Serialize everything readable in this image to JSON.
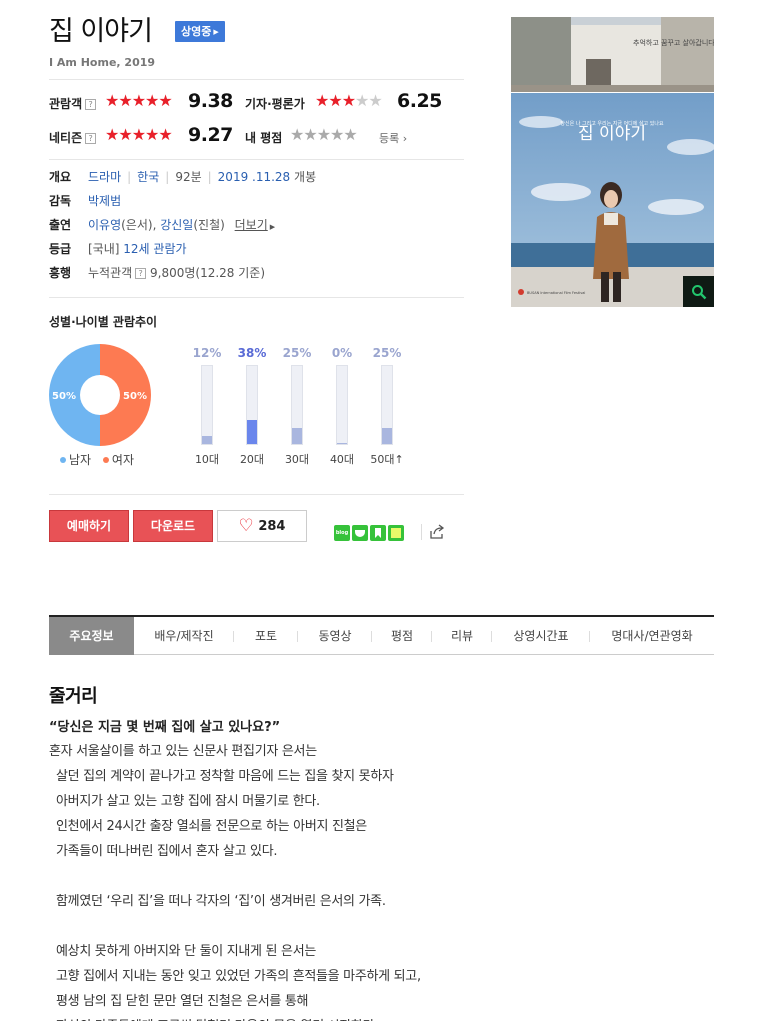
{
  "movie": {
    "title": "집 이야기",
    "status_badge": "상영중",
    "subtitle": "I Am Home, 2019"
  },
  "ratings": {
    "audience": {
      "label": "관람객",
      "score": "9.38"
    },
    "critics": {
      "label": "기자·평론가",
      "score": "6.25"
    },
    "netizen": {
      "label": "네티즌",
      "score": "9.27"
    },
    "mine": {
      "label": "내 평점",
      "register": "등록"
    },
    "help_mark": "?"
  },
  "info": {
    "overview": {
      "label": "개요",
      "genre": "드라마",
      "country": "한국",
      "runtime": "92분",
      "release_date": "2019 .11.28",
      "release_suffix": "개봉"
    },
    "director": {
      "label": "감독",
      "value": "박제범"
    },
    "cast": {
      "label": "출연",
      "actor1": "이유영",
      "role1": "(은서)",
      "comma": ", ",
      "actor2": "강신일",
      "role2": "(진철)",
      "more": "더보기"
    },
    "rating_grade": {
      "label": "등급",
      "prefix": "[국내]",
      "value": "12세 관람가"
    },
    "boxoffice": {
      "label": "흥행",
      "prefix": "누적관객",
      "value": "9,800명(12.28 기준)"
    }
  },
  "demographics": {
    "title": "성별·나이별 관람추이",
    "gender": {
      "male": {
        "label": "남자",
        "pct": "50%",
        "value": 50,
        "color": "#6fb5f1"
      },
      "female": {
        "label": "여자",
        "pct": "50%",
        "value": 50,
        "color": "#fd7a52"
      }
    },
    "ages": [
      {
        "label": "10대",
        "pct": "12%",
        "value": 12
      },
      {
        "label": "20대",
        "pct": "38%",
        "value": 38,
        "highlight": true
      },
      {
        "label": "30대",
        "pct": "25%",
        "value": 25
      },
      {
        "label": "40대",
        "pct": "0%",
        "value": 0
      },
      {
        "label": "50대↑",
        "pct": "25%",
        "value": 25
      }
    ]
  },
  "actions": {
    "reserve": "예매하기",
    "download": "다운로드",
    "likes": "284"
  },
  "sns": [
    {
      "icon": "blog-icon",
      "color": "#36c23a"
    },
    {
      "icon": "cafe-icon",
      "color": "#36c23a"
    },
    {
      "icon": "bookmark-icon",
      "color": "#36c23a"
    },
    {
      "icon": "memo-icon",
      "color": "#36c23a"
    }
  ],
  "tabs": [
    "주요정보",
    "배우/제작진",
    "포토",
    "동영상",
    "평점",
    "리뷰",
    "상영시간표",
    "명대사/연관영화"
  ],
  "plot": {
    "title": "줄거리",
    "quote": "“당신은 지금 몇 번째 집에 살고 있나요?”",
    "lines": [
      "혼자 서울살이를 하고 있는 신문사 편집기자 은서는",
      "살던 집의 계약이 끝나가고 정착할 마음에 드는 집을 찾지 못하자",
      "아버지가 살고 있는 고향 집에 잠시 머물기로 한다.",
      "인천에서 24시간 출장 열쇠를 전문으로 하는 아버지 진철은",
      "가족들이 떠나버린 집에서 혼자 살고 있다.",
      "",
      "함께였던 ‘우리 집’을 떠나 각자의 ‘집’이 생겨버린 은서의 가족.",
      "",
      "예상치 못하게 아버지와 단 둘이 지내게 된 은서는",
      "고향 집에서 지내는 동안 잊고 있었던 가족의 흔적들을 마주하게 되고,",
      "평생 남의 집 닫힌 문만 열던 진철은 은서를 통해",
      "자신의 가족들에게 조금씩 닫혔던 마음의 문을 열기 시작한다."
    ]
  },
  "poster": {
    "tagline": "추억하고 꿈꾸고 살아갑니다",
    "mini_title": "집 이야기",
    "caption": "당신은 나 그리고 우리는 지금 어디에 살고 있나요",
    "festival": "BUSAN International Film Festival"
  }
}
